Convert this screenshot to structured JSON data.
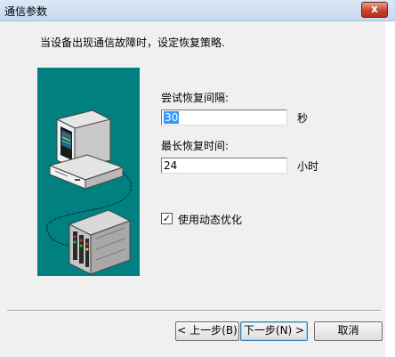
{
  "window": {
    "title": "通信参数",
    "close_label": "x"
  },
  "instruction": "当设备出现通信故障时，设定恢复策略.",
  "retry_interval": {
    "label": "尝试恢复间隔:",
    "value": "30",
    "unit": "秒"
  },
  "max_recovery_time": {
    "label": "最长恢复时间:",
    "value": "24",
    "unit": "小时"
  },
  "dynamic_optimization": {
    "label": "使用动态优化",
    "checked": true,
    "check_glyph": "✓"
  },
  "buttons": {
    "back": "< 上一步(B)",
    "next": "下一步(N) >",
    "cancel": "取消"
  },
  "colors": {
    "illustration_bg": "#008080",
    "titlebar": "#c5d8ef",
    "close": "#c7432c",
    "selection": "#3399ff"
  },
  "icons": [
    "computer-icon",
    "plc-device-icon",
    "close-icon",
    "check-icon"
  ]
}
